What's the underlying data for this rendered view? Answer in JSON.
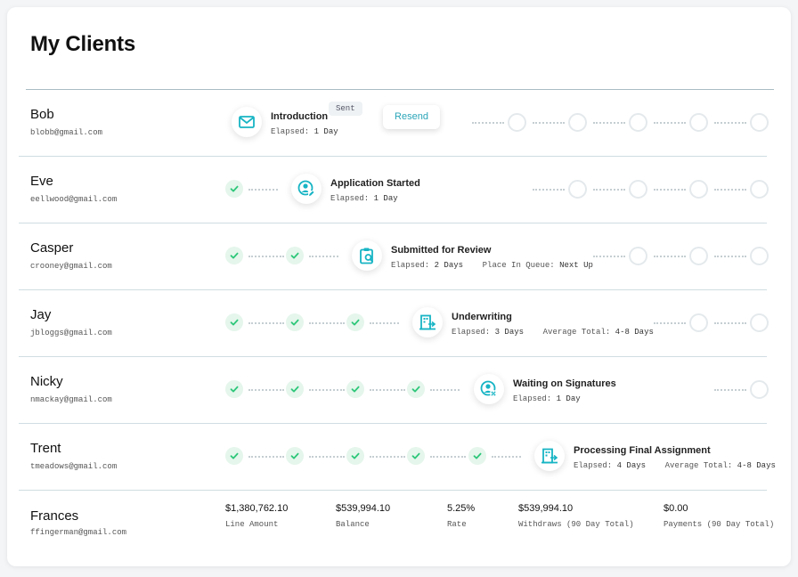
{
  "page": {
    "title": "My Clients"
  },
  "colors": {
    "accent": "#17b4c4",
    "check": "#2ec77a"
  },
  "clients": [
    {
      "name": "Bob",
      "email": "blobb@gmail.com",
      "stage": "Introduction",
      "badge": "Sent",
      "button": "Resend",
      "elapsed": "Elapsed:",
      "elapsed_value": "1 Day",
      "completed_steps": 0,
      "icon": "mail-icon"
    },
    {
      "name": "Eve",
      "email": "eellwood@gmail.com",
      "stage": "Application Started",
      "elapsed": "Elapsed:",
      "elapsed_value": "1 Day",
      "completed_steps": 1,
      "icon": "user-edit-icon"
    },
    {
      "name": "Casper",
      "email": "crooney@gmail.com",
      "stage": "Submitted for Review",
      "elapsed": "Elapsed:",
      "elapsed_value": "2 Days",
      "extra_label": "Place In Queue:",
      "extra_value": "Next Up",
      "completed_steps": 2,
      "icon": "clipboard-search-icon"
    },
    {
      "name": "Jay",
      "email": "jbloggs@gmail.com",
      "stage": "Underwriting",
      "elapsed": "Elapsed:",
      "elapsed_value": "3 Days",
      "extra_label": "Average Total:",
      "extra_value": "4-8 Days",
      "completed_steps": 3,
      "icon": "building-arrow-icon"
    },
    {
      "name": "Nicky",
      "email": "nmackay@gmail.com",
      "stage": "Waiting on Signatures",
      "elapsed": "Elapsed:",
      "elapsed_value": "1 Day",
      "completed_steps": 4,
      "icon": "user-percent-icon"
    },
    {
      "name": "Trent",
      "email": "tmeadows@gmail.com",
      "stage": "Processing Final Assignment",
      "elapsed": "Elapsed:",
      "elapsed_value": "4 Days",
      "extra_label": "Average Total:",
      "extra_value": "4-8 Days",
      "completed_steps": 5,
      "icon": "building-arrow-icon"
    }
  ],
  "summary": {
    "name": "Frances",
    "email": "ffingerman@gmail.com",
    "metrics": [
      {
        "value": "$1,380,762.10",
        "label": "Line Amount"
      },
      {
        "value": "$539,994.10",
        "label": "Balance"
      },
      {
        "value": "5.25%",
        "label": "Rate"
      },
      {
        "value": "$539,994.10",
        "label": "Withdraws (90 Day Total)"
      },
      {
        "value": "$0.00",
        "label": "Payments (90 Day Total)"
      }
    ]
  }
}
